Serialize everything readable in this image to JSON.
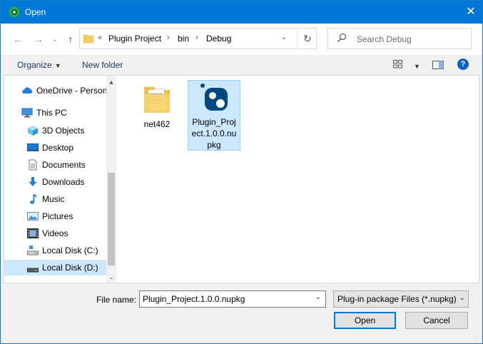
{
  "window": {
    "title": "Open",
    "close_glyph": "✕"
  },
  "nav": {
    "back_glyph": "←",
    "forward_glyph": "→",
    "recent_glyph": "⌄",
    "up_glyph": "↑",
    "breadcrumb_overflow": "«",
    "breadcrumbs": [
      "Plugin Project",
      "bin",
      "Debug"
    ],
    "separator": "›",
    "dropdown_glyph": "⌄",
    "refresh_glyph": "↻"
  },
  "search": {
    "placeholder": "Search Debug"
  },
  "toolbar": {
    "organize_label": "Organize",
    "new_folder_label": "New folder",
    "dropdown_glyph": "▼",
    "help_glyph": "?"
  },
  "sidebar": {
    "items": [
      {
        "label": "OneDrive - Personal",
        "icon": "cloud-icon"
      },
      {
        "label": "This PC",
        "icon": "computer-icon"
      },
      {
        "label": "3D Objects",
        "icon": "cube-icon"
      },
      {
        "label": "Desktop",
        "icon": "desktop-icon"
      },
      {
        "label": "Documents",
        "icon": "documents-icon"
      },
      {
        "label": "Downloads",
        "icon": "download-icon"
      },
      {
        "label": "Music",
        "icon": "music-icon"
      },
      {
        "label": "Pictures",
        "icon": "pictures-icon"
      },
      {
        "label": "Videos",
        "icon": "videos-icon"
      },
      {
        "label": "Local Disk (C:)",
        "icon": "drive-icon"
      },
      {
        "label": "Local Disk (D:)",
        "icon": "drive-icon",
        "selected": true
      }
    ],
    "scroll_up": "▲",
    "scroll_down": "⌄"
  },
  "files": [
    {
      "name": "net462",
      "type": "folder"
    },
    {
      "name": "Plugin_Project.1.0.0.nupkg",
      "type": "nupkg",
      "selected": true,
      "lines": [
        "Plugin_Proj",
        "ect.1.0.0.nu",
        "pkg"
      ]
    }
  ],
  "footer": {
    "file_name_label": "File name:",
    "file_name_value": "Plugin_Project.1.0.0.nupkg",
    "file_type_value": "Plug-in package Files (*.nupkg)",
    "dropdown_glyph": "⌄",
    "open_label": "Open",
    "cancel_label": "Cancel"
  },
  "colors": {
    "titlebar": "#0078d7",
    "selection": "#cce8ff",
    "accent": "#0078d7"
  }
}
